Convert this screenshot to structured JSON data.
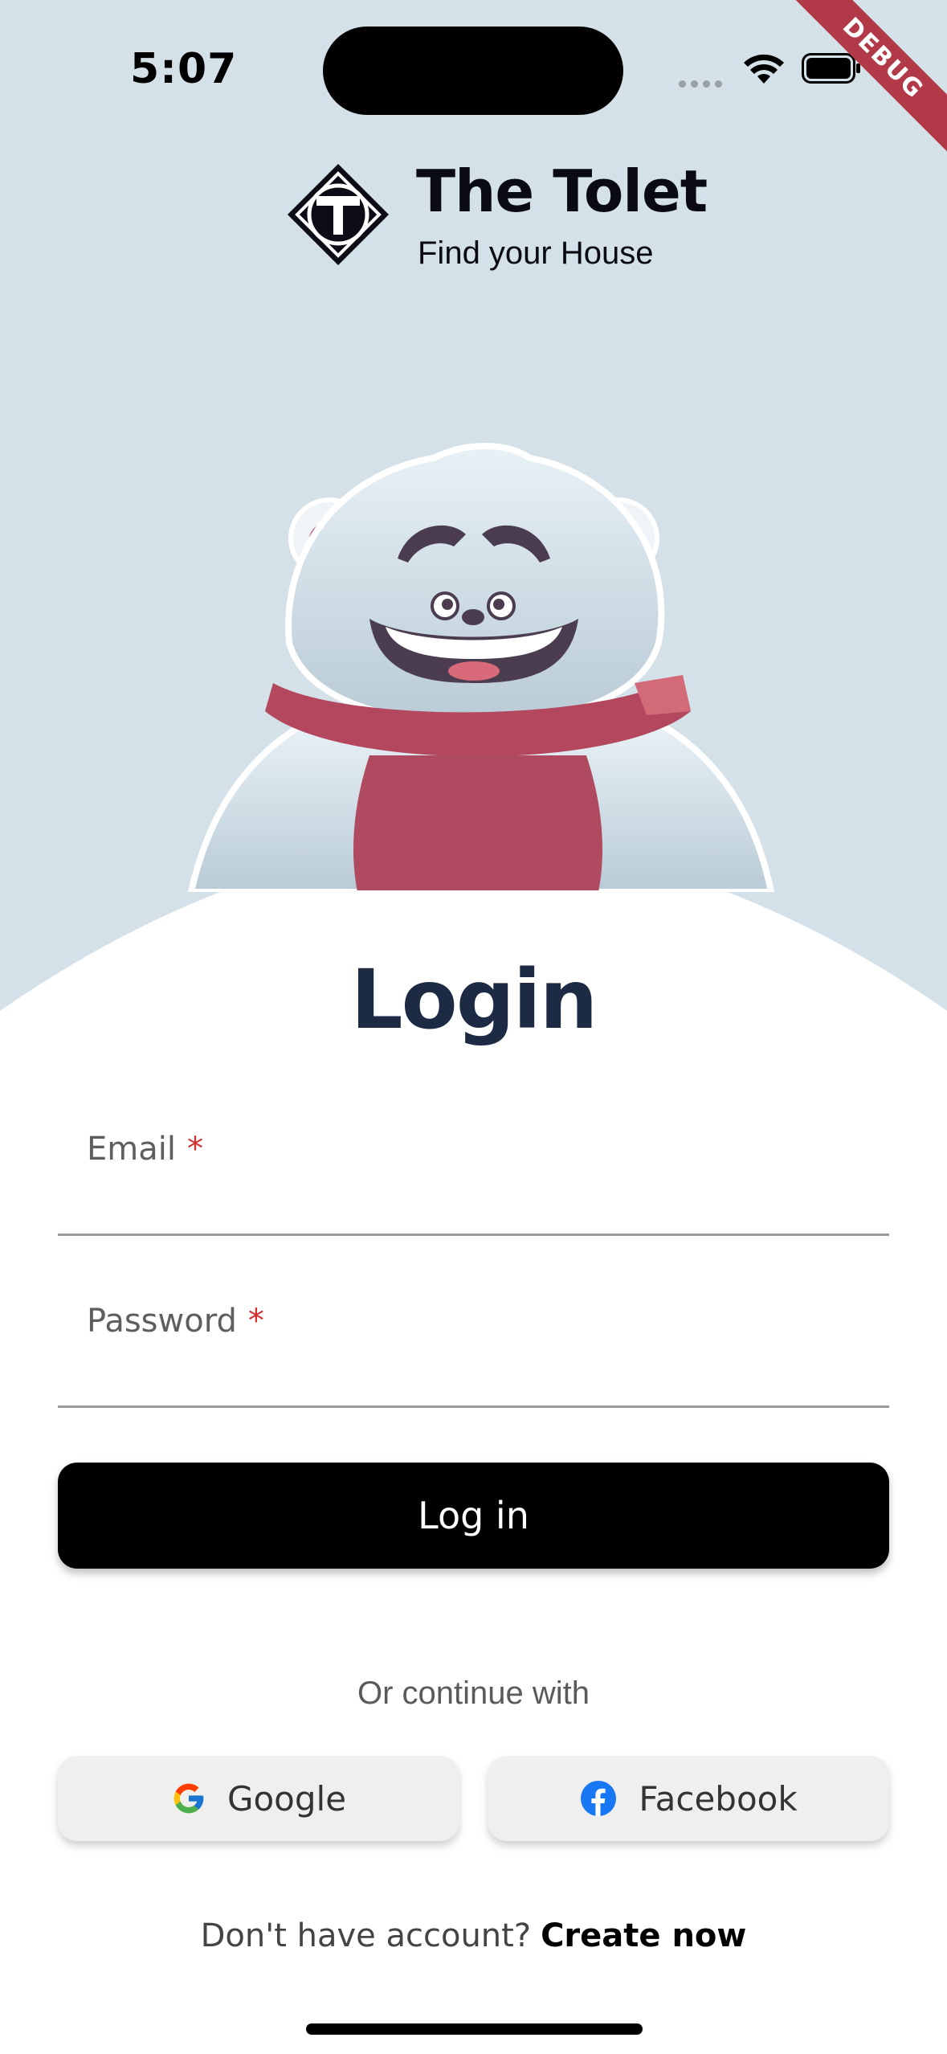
{
  "status_bar": {
    "time": "5:07"
  },
  "debug_banner": "DEBUG",
  "brand": {
    "name": "The Tolet",
    "tagline": "Find your House"
  },
  "login": {
    "title": "Login",
    "email_label": "Email",
    "password_label": "Password",
    "required_mark": "*",
    "submit_label": "Log in",
    "or_text": "Or continue with",
    "google_label": "Google",
    "facebook_label": "Facebook",
    "signup_prompt": "Don't have account?",
    "signup_link": "Create now"
  },
  "colors": {
    "background": "#d5e1e8",
    "title": "#1d2a44",
    "required": "#d32f2f",
    "button": "#000000"
  },
  "icons": [
    "signal-icon",
    "wifi-icon",
    "battery-icon",
    "tolet-logo-icon",
    "bear-mascot",
    "google-icon",
    "facebook-icon"
  ]
}
